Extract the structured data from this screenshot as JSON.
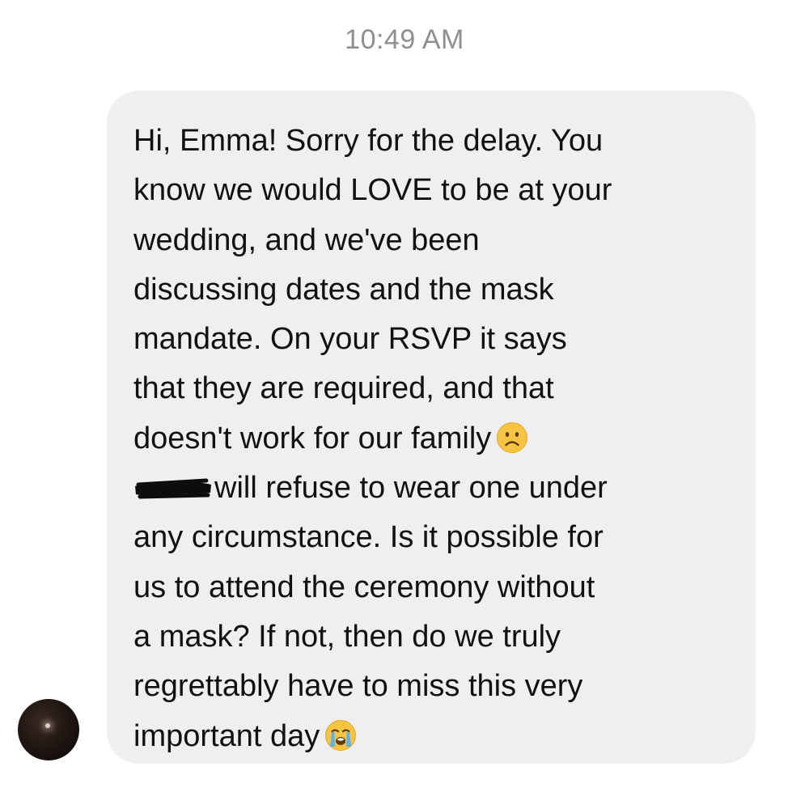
{
  "chat": {
    "timestamp": "10:49 AM",
    "message": {
      "lines": [
        "Hi, Emma! Sorry for the delay. You",
        "know we would LOVE to be at your",
        "wedding, and we've been",
        "discussing dates and the mask",
        "mandate. On your RSVP it says",
        "that they are required, and that",
        "doesn't work for our family",
        "will refuse to wear one under",
        "any circumstance. Is it possible for",
        "us to attend the ceremony without",
        "a mask? If not, then do we truly",
        "regrettably have to miss this very",
        "important day"
      ],
      "emojis": {
        "line7": "frowning-face",
        "line13": "loudly-crying-face"
      },
      "redacted_name": true
    },
    "sender": {
      "avatar_icon": "avatar-photo"
    },
    "colors": {
      "bubble": "#efeff1",
      "text": "#111111",
      "timestamp": "#8e8e93",
      "emoji": "#f6c443"
    }
  }
}
